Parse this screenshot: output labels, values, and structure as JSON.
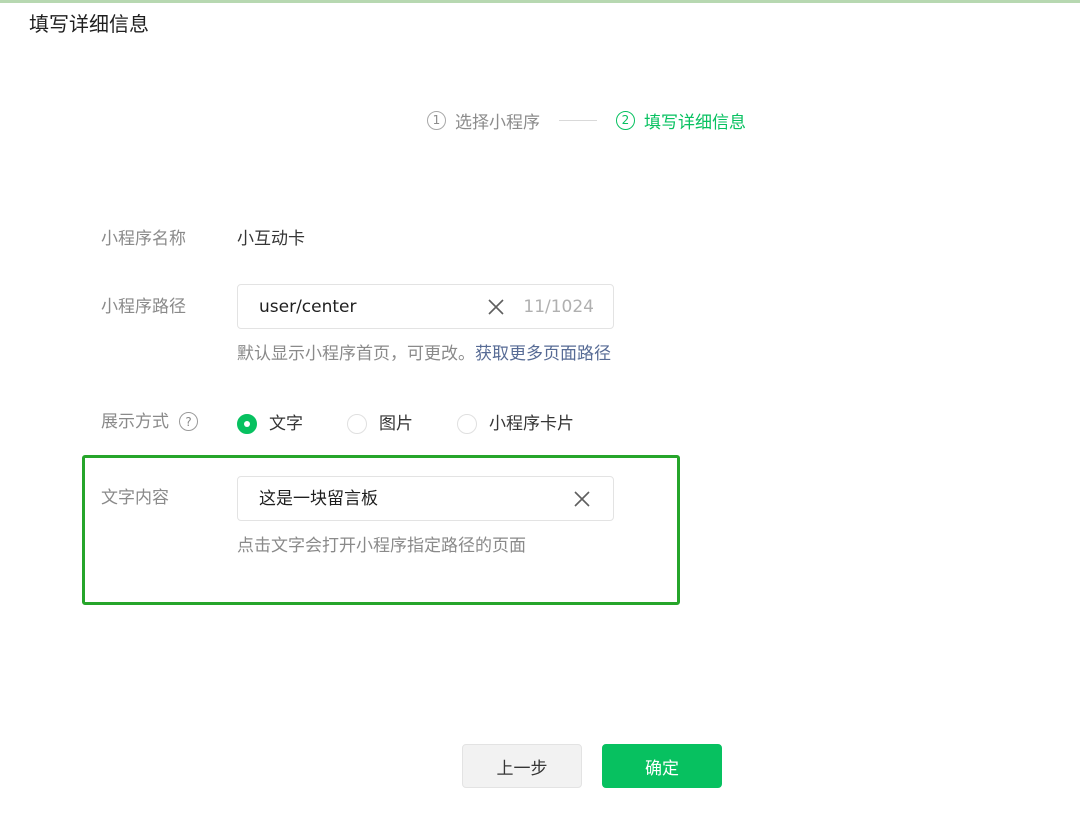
{
  "dialog": {
    "title": "填写详细信息"
  },
  "steps": [
    {
      "num": "1",
      "label": "选择小程序"
    },
    {
      "num": "2",
      "label": "填写详细信息"
    }
  ],
  "form": {
    "name": {
      "label": "小程序名称",
      "value": "小互动卡"
    },
    "path": {
      "label": "小程序路径",
      "value": "user/center",
      "counter": "11/1024",
      "hint": "默认显示小程序首页，可更改。",
      "hint_link": "获取更多页面路径"
    },
    "display": {
      "label": "展示方式",
      "help": "?",
      "options": [
        "文字",
        "图片",
        "小程序卡片"
      ],
      "selected": "文字"
    },
    "text_content": {
      "label": "文字内容",
      "value": "这是一块留言板",
      "hint": "点击文字会打开小程序指定路径的页面"
    }
  },
  "buttons": {
    "prev": "上一步",
    "confirm": "确定"
  },
  "colors": {
    "accent": "#07c160",
    "highlight": "#26a52a",
    "link": "#576b95"
  }
}
